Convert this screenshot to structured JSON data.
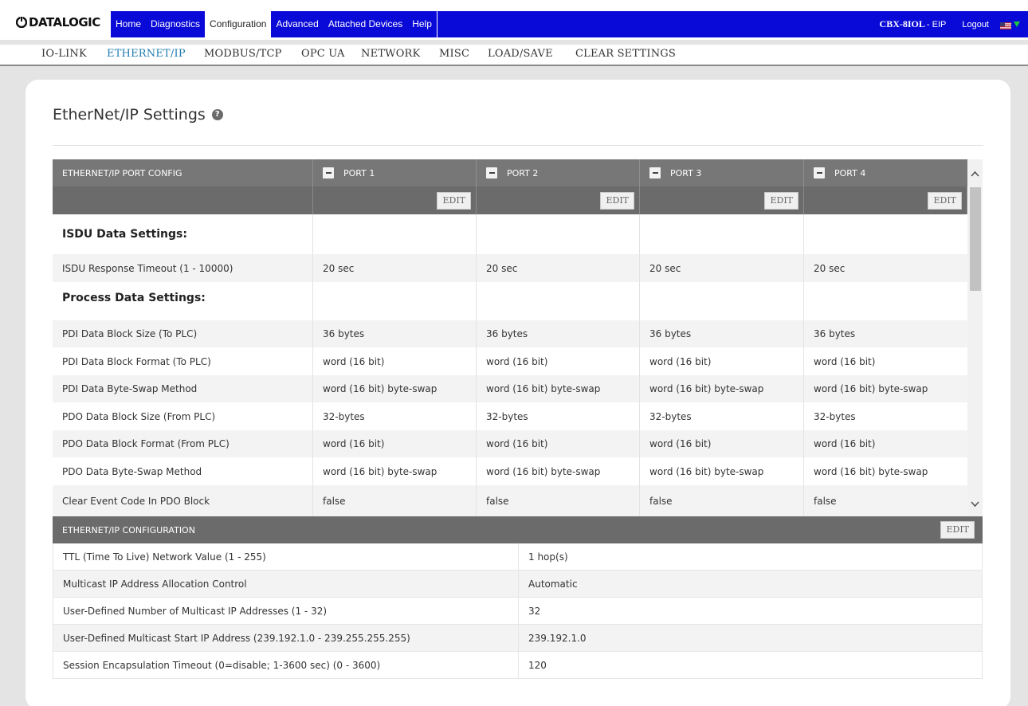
{
  "header": {
    "logo_text": "DATALOGIC",
    "nav": [
      {
        "label": "Home"
      },
      {
        "label": "Diagnostics"
      },
      {
        "label": "Configuration",
        "active": true
      },
      {
        "label": "Advanced"
      },
      {
        "label": "Attached Devices"
      },
      {
        "label": "Help"
      }
    ],
    "device_name": "CBX-8IOL",
    "device_suffix": "- EIP",
    "logout": "Logout",
    "flag_icon": "us-flag-icon",
    "colors": {
      "nav_blue": "#0a0ad8",
      "active_sub": "#1e7bb0"
    }
  },
  "subnav": [
    {
      "label": "IO-LINK"
    },
    {
      "label": "ETHERNET/IP",
      "active": true
    },
    {
      "label": "MODBUS/TCP"
    },
    {
      "label": "OPC UA"
    },
    {
      "label": "NETWORK"
    },
    {
      "label": "MISC"
    },
    {
      "label": "LOAD/SAVE"
    },
    {
      "label": "CLEAR SETTINGS"
    }
  ],
  "page": {
    "title": "EtherNet/IP Settings",
    "help_icon": "?"
  },
  "port_table": {
    "header": "ETHERNET/IP PORT CONFIG",
    "ports": [
      "PORT 1",
      "PORT 2",
      "PORT 3",
      "PORT 4"
    ],
    "edit_label": "EDIT",
    "rows": [
      {
        "label": "ISDU Data Settings:",
        "section": true,
        "values": [
          "",
          "",
          "",
          ""
        ]
      },
      {
        "label": "ISDU Response Timeout (1 - 10000)",
        "values": [
          "20 sec",
          "20 sec",
          "20 sec",
          "20 sec"
        ]
      },
      {
        "label": "Process Data Settings:",
        "section": true,
        "values": [
          "",
          "",
          "",
          ""
        ]
      },
      {
        "label": "PDI Data Block Size (To PLC)",
        "values": [
          "36 bytes",
          "36 bytes",
          "36 bytes",
          "36 bytes"
        ]
      },
      {
        "label": "PDI Data Block Format (To PLC)",
        "values": [
          "word (16 bit)",
          "word (16 bit)",
          "word (16 bit)",
          "word (16 bit)"
        ]
      },
      {
        "label": "PDI Data Byte-Swap Method",
        "values": [
          "word (16 bit) byte-swap",
          "word (16 bit) byte-swap",
          "word (16 bit) byte-swap",
          "word (16 bit) byte-swap"
        ]
      },
      {
        "label": "PDO Data Block Size (From PLC)",
        "values": [
          "32-bytes",
          "32-bytes",
          "32-bytes",
          "32-bytes"
        ]
      },
      {
        "label": "PDO Data Block Format (From PLC)",
        "values": [
          "word (16 bit)",
          "word (16 bit)",
          "word (16 bit)",
          "word (16 bit)"
        ]
      },
      {
        "label": "PDO Data Byte-Swap Method",
        "values": [
          "word (16 bit) byte-swap",
          "word (16 bit) byte-swap",
          "word (16 bit) byte-swap",
          "word (16 bit) byte-swap"
        ]
      },
      {
        "label": "Clear Event Code In PDO Block",
        "values": [
          "false",
          "false",
          "false",
          "false"
        ]
      }
    ]
  },
  "config": {
    "header": "ETHERNET/IP CONFIGURATION",
    "edit_label": "EDIT",
    "rows": [
      {
        "label": "TTL (Time To Live) Network Value (1 - 255)",
        "value": "1 hop(s)"
      },
      {
        "label": "Multicast IP Address Allocation Control",
        "value": "Automatic"
      },
      {
        "label": "User-Defined Number of Multicast IP Addresses (1 - 32)",
        "value": "32"
      },
      {
        "label": "User-Defined Multicast Start IP Address (239.192.1.0 - 239.255.255.255)",
        "value": "239.192.1.0"
      },
      {
        "label": "Session Encapsulation Timeout (0=disable; 1-3600 sec) (0 - 3600)",
        "value": "120"
      }
    ]
  }
}
